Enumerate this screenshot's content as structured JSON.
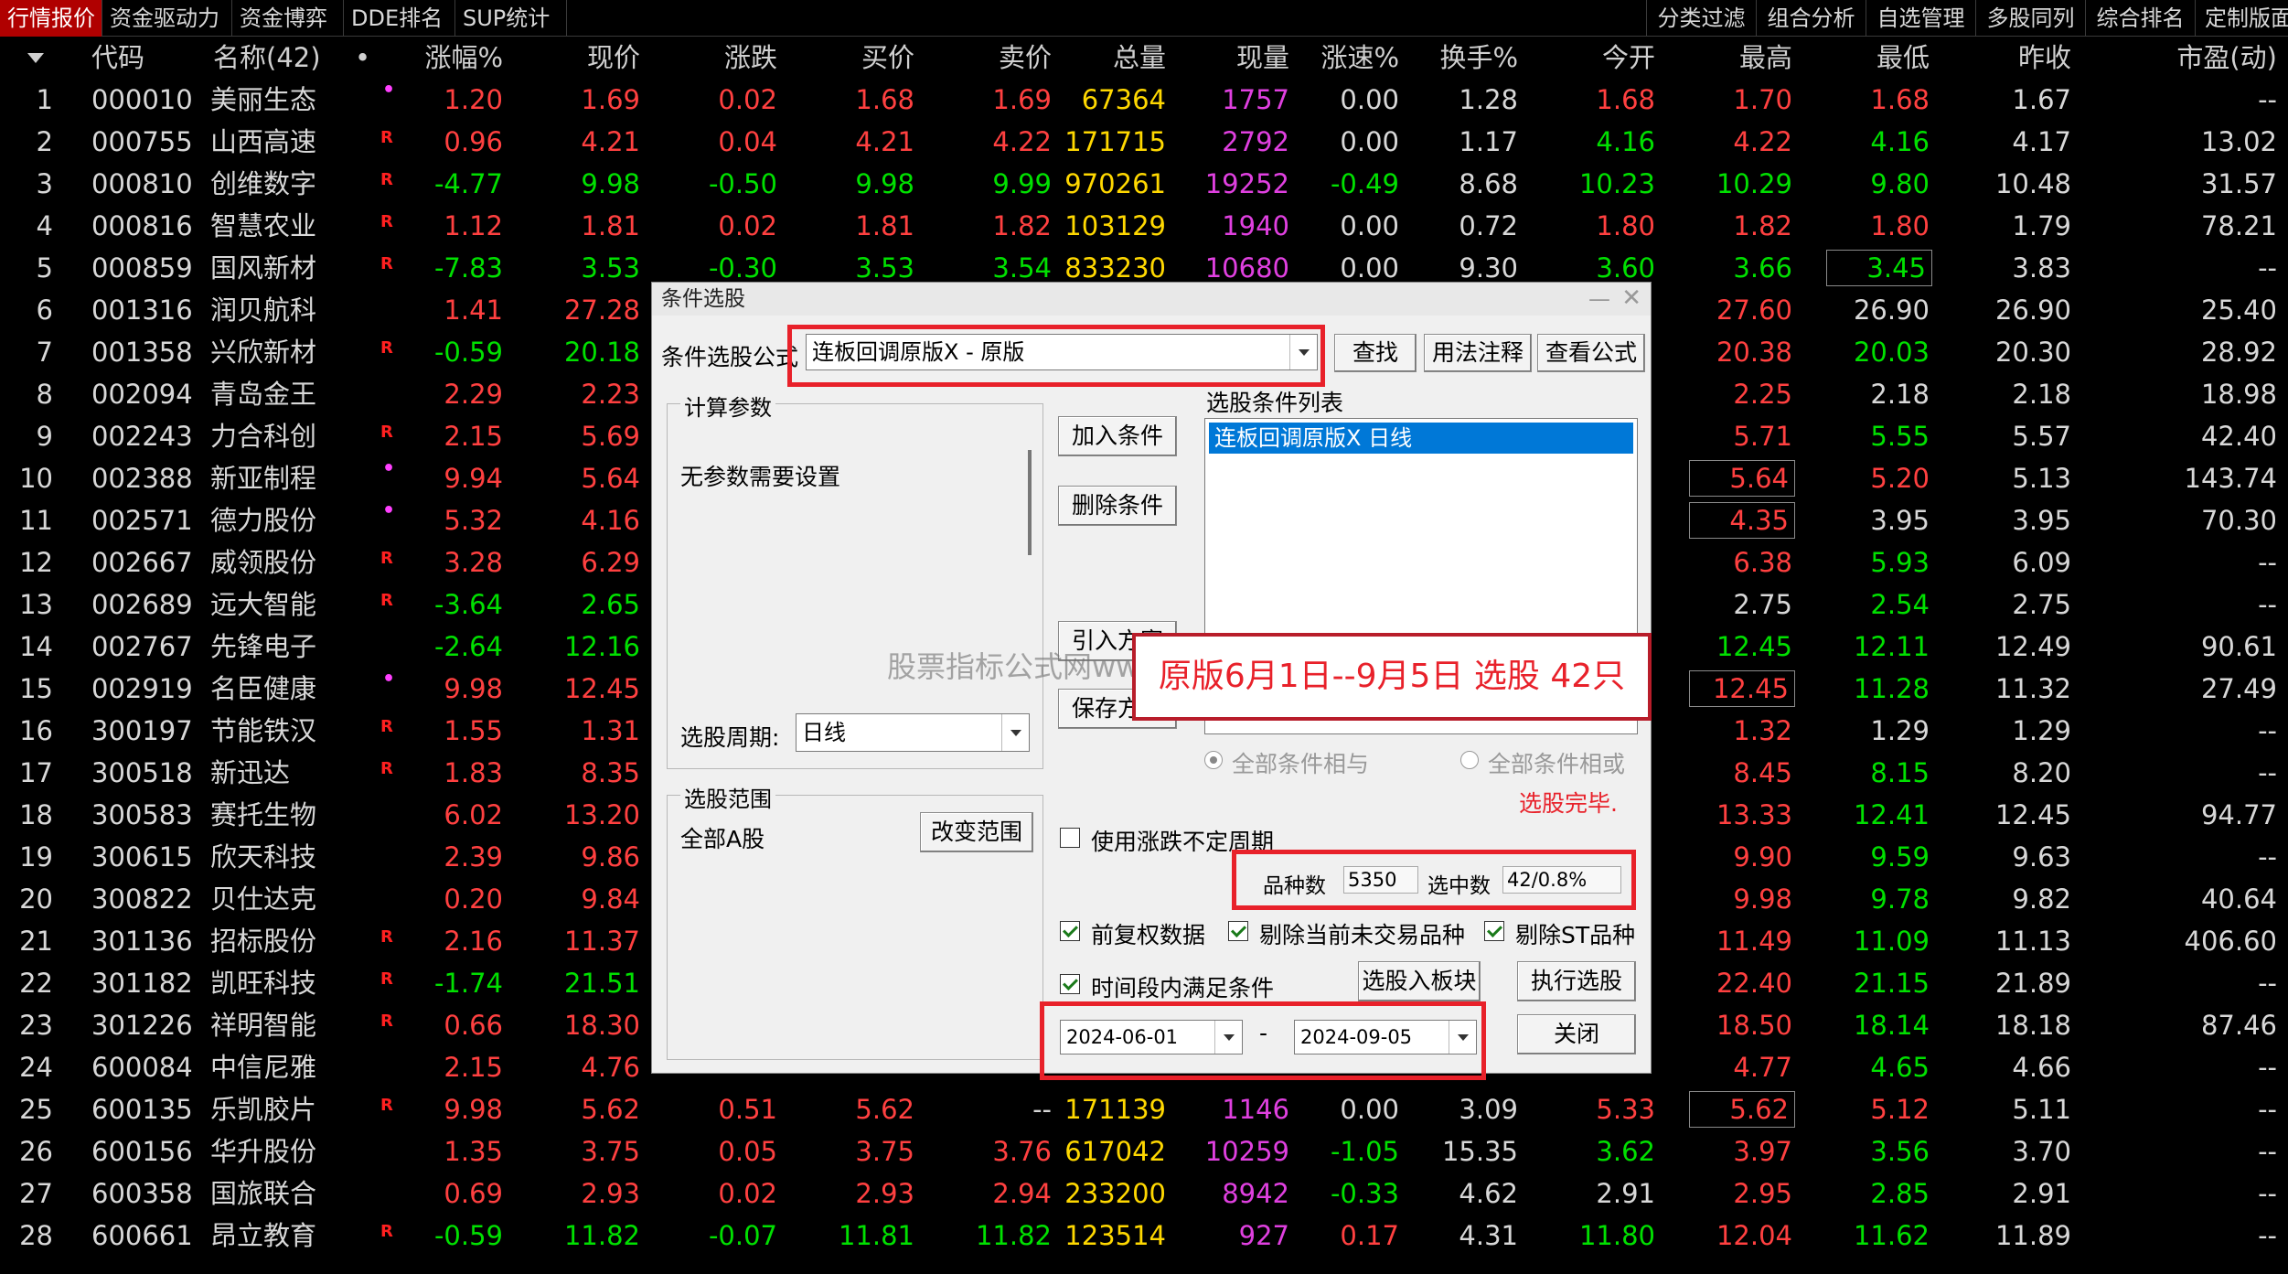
{
  "tabs": [
    "行情报价",
    "资金驱动力",
    "资金博弈",
    "DDE排名",
    "SUP统计"
  ],
  "tabs_right": [
    "分类过滤",
    "组合分析",
    "自选管理",
    "多股同列",
    "综合排名",
    "定制版面"
  ],
  "columns": [
    "代码",
    "名称(42)",
    "•",
    "涨幅%",
    "现价",
    "涨跌",
    "买价",
    "卖价",
    "总量",
    "现量",
    "涨速%",
    "换手%",
    "今开",
    "最高",
    "最低",
    "昨收",
    "市盈(动)"
  ],
  "rows": [
    {
      "n": "1",
      "code": "000010",
      "name": "美丽生态",
      "mark": "•",
      "chg": "1.20",
      "price": "1.69",
      "diff": "0.02",
      "bid": "1.68",
      "ask": "1.69",
      "vol": "67364",
      "cur": "1757",
      "spd": "0.00",
      "turn": "1.28",
      "open": "1.68",
      "high": "1.70",
      "low": "1.68",
      "prev": "1.67",
      "pe": "--"
    },
    {
      "n": "2",
      "code": "000755",
      "name": "山西高速",
      "mark": "R",
      "chg": "0.96",
      "price": "4.21",
      "diff": "0.04",
      "bid": "4.21",
      "ask": "4.22",
      "vol": "171715",
      "cur": "2792",
      "spd": "0.00",
      "turn": "1.17",
      "open": "4.16",
      "high": "4.22",
      "low": "4.16",
      "prev": "4.17",
      "pe": "13.02"
    },
    {
      "n": "3",
      "code": "000810",
      "name": "创维数字",
      "mark": "R",
      "chg": "-4.77",
      "price": "9.98",
      "diff": "-0.50",
      "bid": "9.98",
      "ask": "9.99",
      "vol": "970261",
      "cur": "19252",
      "spd": "-0.49",
      "turn": "8.68",
      "open": "10.23",
      "high": "10.29",
      "low": "9.80",
      "prev": "10.48",
      "pe": "31.57"
    },
    {
      "n": "4",
      "code": "000816",
      "name": "智慧农业",
      "mark": "R",
      "chg": "1.12",
      "price": "1.81",
      "diff": "0.02",
      "bid": "1.81",
      "ask": "1.82",
      "vol": "103129",
      "cur": "1940",
      "spd": "0.00",
      "turn": "0.72",
      "open": "1.80",
      "high": "1.82",
      "low": "1.80",
      "prev": "1.79",
      "pe": "78.21"
    },
    {
      "n": "5",
      "code": "000859",
      "name": "国风新材",
      "mark": "R",
      "chg": "-7.83",
      "price": "3.53",
      "diff": "-0.30",
      "bid": "3.53",
      "ask": "3.54",
      "vol": "833230",
      "cur": "10680",
      "spd": "0.00",
      "turn": "9.30",
      "open": "3.60",
      "high": "3.66",
      "low": "3.45",
      "prev": "3.83",
      "pe": "--"
    },
    {
      "n": "6",
      "code": "001316",
      "name": "润贝航科",
      "mark": "",
      "chg": "1.41",
      "price": "27.28",
      "diff": "",
      "bid": "",
      "ask": "",
      "vol": "",
      "cur": "",
      "spd": "",
      "turn": "",
      "open": "",
      "high": "27.60",
      "low": "26.90",
      "prev": "26.90",
      "pe": "25.40"
    },
    {
      "n": "7",
      "code": "001358",
      "name": "兴欣新材",
      "mark": "R",
      "chg": "-0.59",
      "price": "20.18",
      "diff": "",
      "bid": "",
      "ask": "",
      "vol": "",
      "cur": "",
      "spd": "",
      "turn": "",
      "open": "",
      "high": "20.38",
      "low": "20.03",
      "prev": "20.30",
      "pe": "28.92"
    },
    {
      "n": "8",
      "code": "002094",
      "name": "青岛金王",
      "mark": "",
      "chg": "2.29",
      "price": "2.23",
      "diff": "",
      "bid": "",
      "ask": "",
      "vol": "",
      "cur": "",
      "spd": "",
      "turn": "",
      "open": "",
      "high": "2.25",
      "low": "2.18",
      "prev": "2.18",
      "pe": "18.98"
    },
    {
      "n": "9",
      "code": "002243",
      "name": "力合科创",
      "mark": "R",
      "chg": "2.15",
      "price": "5.69",
      "diff": "",
      "bid": "",
      "ask": "",
      "vol": "",
      "cur": "",
      "spd": "",
      "turn": "",
      "open": "",
      "high": "5.71",
      "low": "5.55",
      "prev": "5.57",
      "pe": "42.40"
    },
    {
      "n": "10",
      "code": "002388",
      "name": "新亚制程",
      "mark": "•",
      "chg": "9.94",
      "price": "5.64",
      "diff": "",
      "bid": "",
      "ask": "",
      "vol": "",
      "cur": "",
      "spd": "",
      "turn": "",
      "open": "",
      "high": "5.64",
      "low": "5.20",
      "prev": "5.13",
      "pe": "143.74"
    },
    {
      "n": "11",
      "code": "002571",
      "name": "德力股份",
      "mark": "•",
      "chg": "5.32",
      "price": "4.16",
      "diff": "",
      "bid": "",
      "ask": "",
      "vol": "",
      "cur": "",
      "spd": "",
      "turn": "",
      "open": "",
      "high": "4.35",
      "low": "3.95",
      "prev": "3.95",
      "pe": "70.30"
    },
    {
      "n": "12",
      "code": "002667",
      "name": "威领股份",
      "mark": "R",
      "chg": "3.28",
      "price": "6.29",
      "diff": "",
      "bid": "",
      "ask": "",
      "vol": "",
      "cur": "",
      "spd": "",
      "turn": "",
      "open": "",
      "high": "6.38",
      "low": "5.93",
      "prev": "6.09",
      "pe": "--"
    },
    {
      "n": "13",
      "code": "002689",
      "name": "远大智能",
      "mark": "R",
      "chg": "-3.64",
      "price": "2.65",
      "diff": "",
      "bid": "",
      "ask": "",
      "vol": "",
      "cur": "",
      "spd": "",
      "turn": "",
      "open": "",
      "high": "2.75",
      "low": "2.54",
      "prev": "2.75",
      "pe": "--"
    },
    {
      "n": "14",
      "code": "002767",
      "name": "先锋电子",
      "mark": "",
      "chg": "-2.64",
      "price": "12.16",
      "diff": "",
      "bid": "",
      "ask": "",
      "vol": "",
      "cur": "",
      "spd": "",
      "turn": "",
      "open": "",
      "high": "12.45",
      "low": "12.11",
      "prev": "12.49",
      "pe": "90.61"
    },
    {
      "n": "15",
      "code": "002919",
      "name": "名臣健康",
      "mark": "•",
      "chg": "9.98",
      "price": "12.45",
      "diff": "",
      "bid": "",
      "ask": "",
      "vol": "",
      "cur": "",
      "spd": "",
      "turn": "",
      "open": "",
      "high": "12.45",
      "low": "11.28",
      "prev": "11.32",
      "pe": "27.49"
    },
    {
      "n": "16",
      "code": "300197",
      "name": "节能铁汉",
      "mark": "R",
      "chg": "1.55",
      "price": "1.31",
      "diff": "",
      "bid": "",
      "ask": "",
      "vol": "",
      "cur": "",
      "spd": "",
      "turn": "",
      "open": "",
      "high": "1.32",
      "low": "1.29",
      "prev": "1.29",
      "pe": "--"
    },
    {
      "n": "17",
      "code": "300518",
      "name": "新迅达",
      "mark": "R",
      "chg": "1.83",
      "price": "8.35",
      "diff": "",
      "bid": "",
      "ask": "",
      "vol": "",
      "cur": "",
      "spd": "",
      "turn": "",
      "open": "",
      "high": "8.45",
      "low": "8.15",
      "prev": "8.20",
      "pe": "--"
    },
    {
      "n": "18",
      "code": "300583",
      "name": "赛托生物",
      "mark": "",
      "chg": "6.02",
      "price": "13.20",
      "diff": "",
      "bid": "",
      "ask": "",
      "vol": "",
      "cur": "",
      "spd": "",
      "turn": "",
      "open": "",
      "high": "13.33",
      "low": "12.41",
      "prev": "12.45",
      "pe": "94.77"
    },
    {
      "n": "19",
      "code": "300615",
      "name": "欣天科技",
      "mark": "",
      "chg": "2.39",
      "price": "9.86",
      "diff": "",
      "bid": "",
      "ask": "",
      "vol": "",
      "cur": "",
      "spd": "",
      "turn": "",
      "open": "",
      "high": "9.90",
      "low": "9.59",
      "prev": "9.63",
      "pe": "--"
    },
    {
      "n": "20",
      "code": "300822",
      "name": "贝仕达克",
      "mark": "",
      "chg": "0.20",
      "price": "9.84",
      "diff": "",
      "bid": "",
      "ask": "",
      "vol": "",
      "cur": "",
      "spd": "",
      "turn": "",
      "open": "",
      "high": "9.98",
      "low": "9.78",
      "prev": "9.82",
      "pe": "40.64"
    },
    {
      "n": "21",
      "code": "301136",
      "name": "招标股份",
      "mark": "R",
      "chg": "2.16",
      "price": "11.37",
      "diff": "",
      "bid": "",
      "ask": "",
      "vol": "",
      "cur": "",
      "spd": "",
      "turn": "",
      "open": "",
      "high": "11.49",
      "low": "11.09",
      "prev": "11.13",
      "pe": "406.60"
    },
    {
      "n": "22",
      "code": "301182",
      "name": "凯旺科技",
      "mark": "R",
      "chg": "-1.74",
      "price": "21.51",
      "diff": "",
      "bid": "",
      "ask": "",
      "vol": "",
      "cur": "",
      "spd": "",
      "turn": "",
      "open": "",
      "high": "22.40",
      "low": "21.15",
      "prev": "21.89",
      "pe": "--"
    },
    {
      "n": "23",
      "code": "301226",
      "name": "祥明智能",
      "mark": "R",
      "chg": "0.66",
      "price": "18.30",
      "diff": "",
      "bid": "",
      "ask": "",
      "vol": "",
      "cur": "",
      "spd": "",
      "turn": "",
      "open": "",
      "high": "18.50",
      "low": "18.14",
      "prev": "18.18",
      "pe": "87.46"
    },
    {
      "n": "24",
      "code": "600084",
      "name": "中信尼雅",
      "mark": "",
      "chg": "2.15",
      "price": "4.76",
      "diff": "",
      "bid": "",
      "ask": "",
      "vol": "",
      "cur": "",
      "spd": "",
      "turn": "",
      "open": "",
      "high": "4.77",
      "low": "4.65",
      "prev": "4.66",
      "pe": "--"
    },
    {
      "n": "25",
      "code": "600135",
      "name": "乐凯胶片",
      "mark": "R",
      "chg": "9.98",
      "price": "5.62",
      "diff": "0.51",
      "bid": "5.62",
      "ask": "--",
      "vol": "171139",
      "cur": "1146",
      "spd": "0.00",
      "turn": "3.09",
      "open": "5.33",
      "high": "5.62",
      "low": "5.12",
      "prev": "5.11",
      "pe": "--"
    },
    {
      "n": "26",
      "code": "600156",
      "name": "华升股份",
      "mark": "",
      "chg": "1.35",
      "price": "3.75",
      "diff": "0.05",
      "bid": "3.75",
      "ask": "3.76",
      "vol": "617042",
      "cur": "10259",
      "spd": "-1.05",
      "turn": "15.35",
      "open": "3.62",
      "high": "3.97",
      "low": "3.56",
      "prev": "3.70",
      "pe": "--"
    },
    {
      "n": "27",
      "code": "600358",
      "name": "国旅联合",
      "mark": "",
      "chg": "0.69",
      "price": "2.93",
      "diff": "0.02",
      "bid": "2.93",
      "ask": "2.94",
      "vol": "233200",
      "cur": "8942",
      "spd": "-0.33",
      "turn": "4.62",
      "open": "2.91",
      "high": "2.95",
      "low": "2.85",
      "prev": "2.91",
      "pe": "--"
    },
    {
      "n": "28",
      "code": "600661",
      "name": "昂立教育",
      "mark": "R",
      "chg": "-0.59",
      "price": "11.82",
      "diff": "-0.07",
      "bid": "11.81",
      "ask": "11.82",
      "vol": "123514",
      "cur": "927",
      "spd": "0.17",
      "turn": "4.31",
      "open": "11.80",
      "high": "12.04",
      "low": "11.62",
      "prev": "11.89",
      "pe": "--"
    }
  ],
  "dialog": {
    "title": "条件选股",
    "formula_label": "条件选股公式",
    "formula_value": "连板回调原版X  -  原版",
    "btn_search": "查找",
    "btn_usage": "用法注释",
    "btn_view": "查看公式",
    "params_group": "计算参数",
    "params_text": "无参数需要设置",
    "cond_list_label": "选股条件列表",
    "cond_item": "连板回调原版X   日线",
    "btn_add": "加入条件",
    "btn_delete": "删除条件",
    "btn_import": "引入方案",
    "btn_save": "保存方案",
    "period_label": "选股周期:",
    "period_value": "日线",
    "radio_and": "全部条件相与",
    "radio_or": "全部条件相或",
    "status": "选股完毕.",
    "range_group": "选股范围",
    "range_value": "全部A股",
    "btn_range": "改变范围",
    "chk_uncertain": "使用涨跌不定周期",
    "count_label": "品种数",
    "count_value": "5350",
    "selected_label": "选中数",
    "selected_value": "42/0.8%",
    "chk_fq": "前复权数据",
    "chk_notrade": "剔除当前未交易品种",
    "chk_st": "剔除ST品种",
    "chk_period": "时间段内满足条件",
    "btn_to_block": "选股入板块",
    "btn_run": "执行选股",
    "date_from": "2024-06-01",
    "date_sep": "-",
    "date_to": "2024-09-05",
    "btn_close": "关闭"
  },
  "annotation": "原版6月1日--9月5日 选股 42只",
  "watermark": "股票指标公式网www.gupiaozbs.com",
  "colors": {
    "up": "#ff4040",
    "down": "#00e000",
    "volume": "#ffd800",
    "curvol": "#e040e0",
    "active_tab": "#b00000",
    "highlight_box": "#e8212a"
  }
}
